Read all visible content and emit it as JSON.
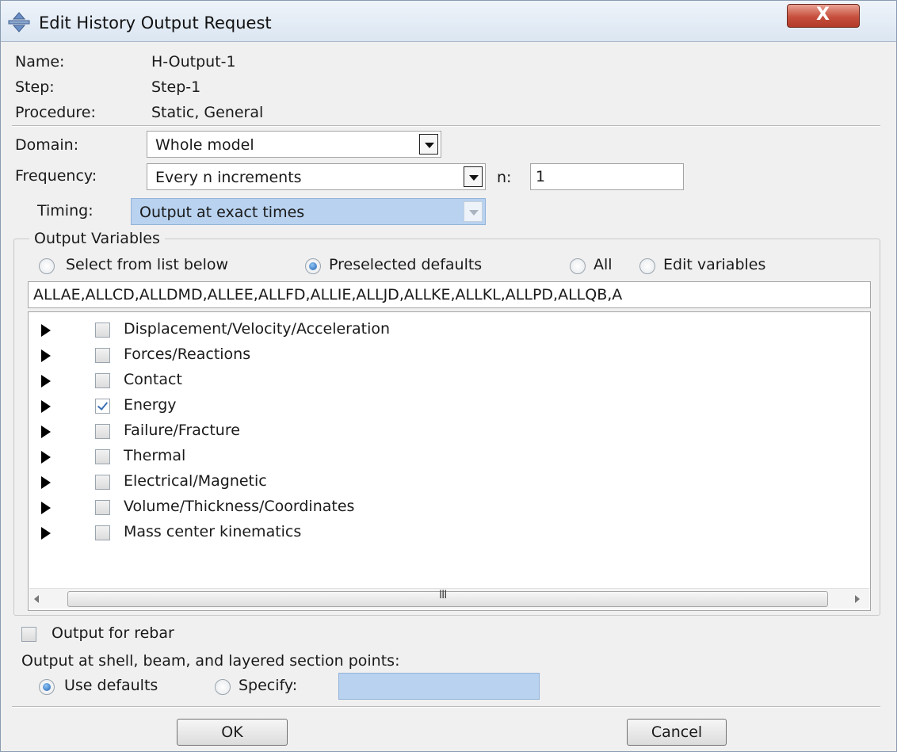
{
  "window": {
    "title": "Edit History Output Request",
    "close_glyph": "X"
  },
  "info": {
    "name_label": "Name:",
    "name_value": "H-Output-1",
    "step_label": "Step:",
    "step_value": "Step-1",
    "procedure_label": "Procedure:",
    "procedure_value": "Static, General"
  },
  "domain": {
    "label": "Domain:",
    "value": "Whole model"
  },
  "frequency": {
    "label": "Frequency:",
    "value": "Every n increments",
    "n_label": "n:",
    "n_value": "1"
  },
  "timing": {
    "label": "Timing:",
    "value": "Output at exact times",
    "enabled": false
  },
  "output_variables": {
    "group_label": "Output Variables",
    "radios": [
      {
        "label": "Select from list below",
        "selected": false
      },
      {
        "label": "Preselected defaults",
        "selected": true
      },
      {
        "label": "All",
        "selected": false
      },
      {
        "label": "Edit variables",
        "selected": false
      }
    ],
    "variables_text": "ALLAE,ALLCD,ALLDMD,ALLEE,ALLFD,ALLIE,ALLJD,ALLKE,ALLKL,ALLPD,ALLQB,A",
    "tree_items": [
      {
        "label": "Displacement/Velocity/Acceleration",
        "checked": false
      },
      {
        "label": "Forces/Reactions",
        "checked": false
      },
      {
        "label": "Contact",
        "checked": false
      },
      {
        "label": "Energy",
        "checked": true
      },
      {
        "label": "Failure/Fracture",
        "checked": false
      },
      {
        "label": "Thermal",
        "checked": false
      },
      {
        "label": "Electrical/Magnetic",
        "checked": false
      },
      {
        "label": "Volume/Thickness/Coordinates",
        "checked": false
      },
      {
        "label": "Mass center kinematics",
        "checked": false
      }
    ],
    "scroll_grip": "III"
  },
  "rebar": {
    "label": "Output for rebar",
    "checked": false
  },
  "section_points": {
    "label": "Output at shell, beam, and layered section points:",
    "use_defaults_label": "Use defaults",
    "use_defaults_selected": true,
    "specify_label": "Specify:",
    "specify_value": ""
  },
  "buttons": {
    "ok": "OK",
    "cancel": "Cancel"
  },
  "icons": {
    "title": "abaqus-move-icon",
    "close": "close-icon",
    "expander": "triangle-right-icon"
  },
  "colors": {
    "disabled_field": "#b8d2f0",
    "close_button": "#c6503d",
    "check": "#3b6fb6"
  }
}
